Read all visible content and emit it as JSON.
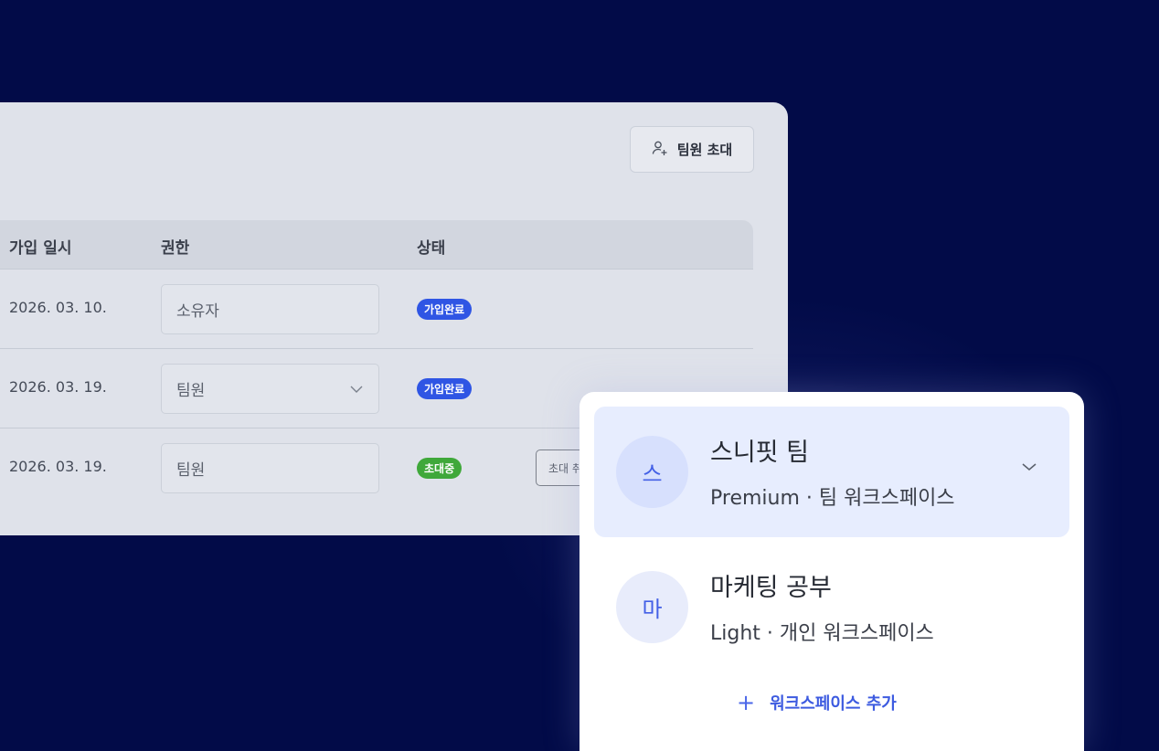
{
  "members_panel": {
    "invite_button": {
      "label": "팀원 초대",
      "icon": "user-plus-icon"
    },
    "columns": [
      "가입 일시",
      "권한",
      "상태"
    ],
    "rows": [
      {
        "joined": "2026. 03. 10.",
        "role": "소유자",
        "role_editable": false,
        "status": "가입완료",
        "status_color": "#2f55e4"
      },
      {
        "joined": "2026. 03. 19.",
        "role": "팀원",
        "role_editable": true,
        "status": "가입완료",
        "status_color": "#2f55e4"
      },
      {
        "joined": "2026. 03. 19.",
        "role": "팀원",
        "role_editable": false,
        "status": "초대중",
        "status_color": "#3fa83a",
        "action_label": "초대 취소"
      }
    ]
  },
  "workspace_switcher": {
    "workspaces": [
      {
        "initial": "스",
        "name": "스니핏 팀",
        "detail": "Premium · 팀 워크스페이스",
        "active": true
      },
      {
        "initial": "마",
        "name": "마케팅 공부",
        "detail": "Light · 개인 워크스페이스",
        "active": false
      }
    ],
    "add_label": "워크스페이스 추가",
    "accent_color": "#3d5be0"
  }
}
